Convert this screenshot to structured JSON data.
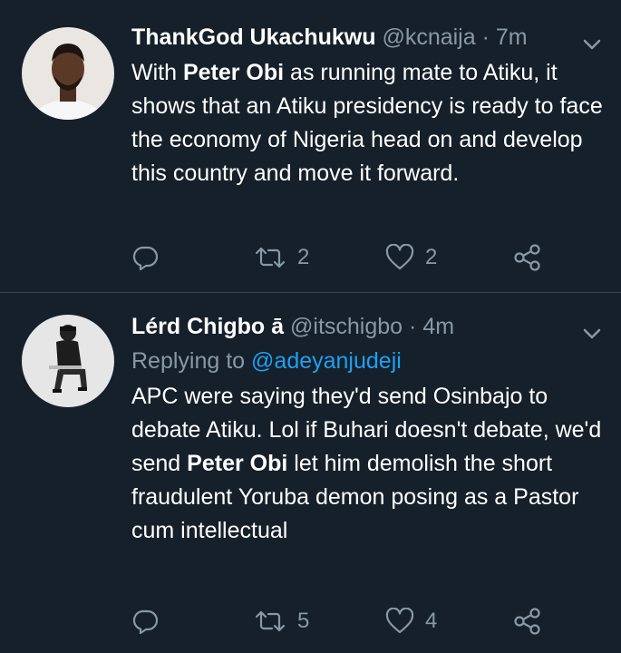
{
  "tweets": [
    {
      "name": "ThankGod Ukachukwu",
      "handle": "@kcnaija",
      "separator": "·",
      "time": "7m",
      "text_before": "With ",
      "text_bold": "Peter Obi",
      "text_after": " as running mate to Atiku, it shows that an Atiku presidency is ready to face the economy of Nigeria head on and develop this country and move it forward.",
      "retweets": "2",
      "likes": "2"
    },
    {
      "name": "Lérd Chigbo ā",
      "handle": "@itschigbo",
      "separator": "·",
      "time": "4m",
      "replying_label": "Replying to",
      "replying_to": "@adeyanjudeji",
      "text_before": "APC were saying they'd send Osinbajo to debate Atiku. Lol if Buhari doesn't debate, we'd send ",
      "text_bold": "Peter Obi",
      "text_after": " let him demolish the short fraudulent Yoruba demon posing as a Pastor cum intellectual",
      "retweets": "5",
      "likes": "4"
    }
  ],
  "icons": [
    "avatar",
    "chevron-down-icon",
    "reply-icon",
    "retweet-icon",
    "like-icon",
    "share-icon"
  ],
  "colors": {
    "background": "#15202b",
    "secondary": "#8899a6",
    "link": "#1da1f2",
    "divider": "#38444d"
  }
}
